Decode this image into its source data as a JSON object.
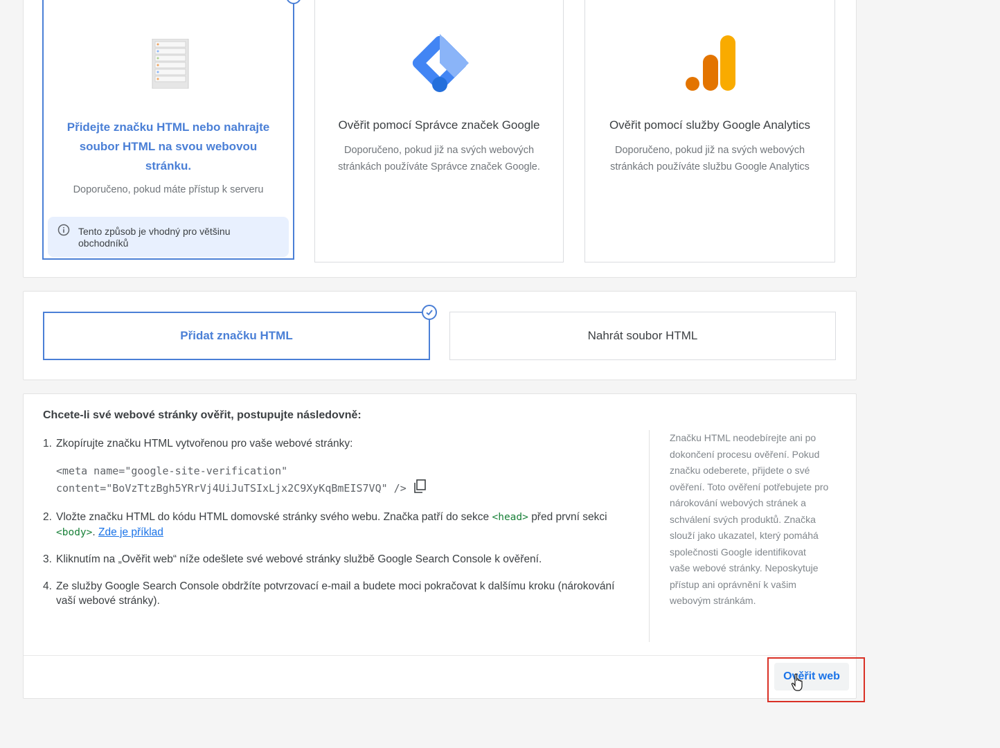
{
  "methods": {
    "html_tag": {
      "title": "Přidejte značku HTML nebo nahrajte soubor HTML na svou webovou stránku.",
      "subtitle": "Doporučeno, pokud máte přístup k serveru",
      "info": "Tento způsob je vhodný pro většinu obchodníků",
      "icon": "server-icon",
      "selected": true
    },
    "gtm": {
      "title": "Ověřit pomocí Správce značek Google",
      "subtitle": "Doporučeno, pokud již na svých webových stránkách používáte Správce značek Google.",
      "icon": "google-tag-manager-icon"
    },
    "ga": {
      "title": "Ověřit pomocí služby Google Analytics",
      "subtitle": "Doporučeno, pokud již na svých webových stránkách používáte službu Google Analytics",
      "icon": "google-analytics-icon"
    }
  },
  "html_options": {
    "add_tag": "Přidat značku HTML",
    "upload_file": "Nahrát soubor HTML",
    "selected": "add_tag"
  },
  "steps": {
    "heading": "Chcete-li své webové stránky ověřit, postupujte následovně:",
    "items": [
      {
        "num": "1.",
        "text": "Zkopírujte značku HTML vytvořenou pro vaše webové stránky:"
      },
      {
        "num": "2.",
        "text_a": "Vložte značku HTML do kódu HTML domovské stránky svého webu. Značka patří do sekce",
        "tag_head": "<head>",
        "text_b": "před první sekci",
        "tag_body": "<body>",
        "text_c": ".",
        "link": "Zde je příklad"
      },
      {
        "num": "3.",
        "text": "Kliknutím na „Ověřit web“ níže odešlete své webové stránky službě Google Search Console k ověření."
      },
      {
        "num": "4.",
        "text": "Ze služby Google Search Console obdržíte potvrzovací e-mail a budete moci pokračovat k dalšímu kroku (nárokování vaší webové stránky)."
      }
    ],
    "code_line1": "<meta name=\"google-site-verification\"",
    "code_line2": "content=\"BoVzTtzBgh5YRrVj4UiJuTSIxLjx2C9XyKqBmEIS7VQ\" />",
    "side_note": "Značku HTML neodebírejte ani po dokončení procesu ověření. Pokud značku odeberete, přijdete o své ověření. Toto ověření potřebujete pro nárokování webových stránek a schválení svých produktů. Značka slouží jako ukazatel, který pomáhá společnosti Google identifikovat vaše webové stránky. Neposkytuje přístup ani oprávnění k vašim webovým stránkám."
  },
  "actions": {
    "verify_label": "Ověřit web"
  },
  "colors": {
    "accent": "#4a7fd6",
    "link": "#1a73e8",
    "highlight": "#d93025"
  }
}
